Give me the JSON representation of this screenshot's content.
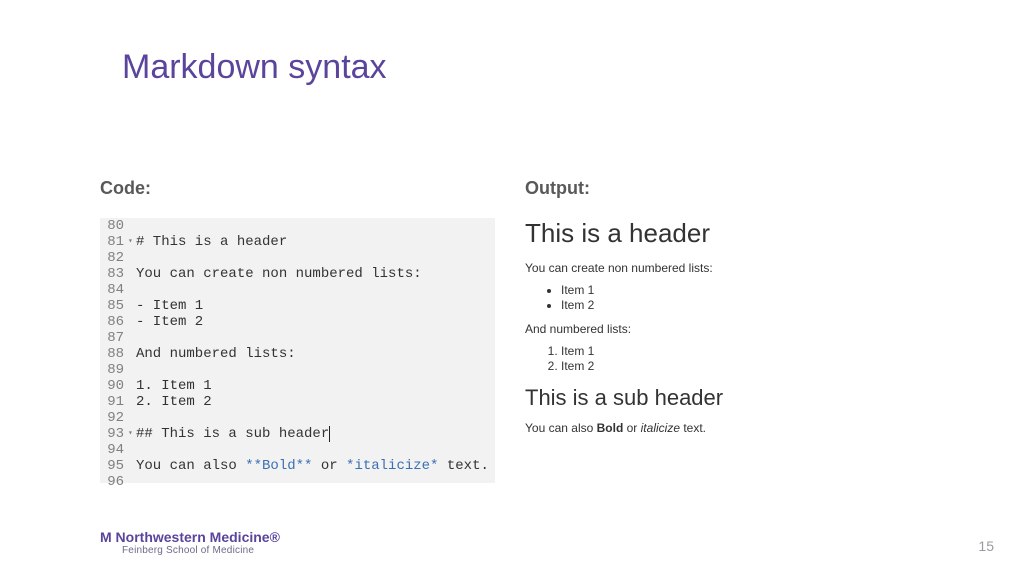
{
  "title": "Markdown syntax",
  "labels": {
    "code": "Code:",
    "output": "Output:"
  },
  "code": {
    "lines": [
      {
        "num": "80",
        "fold": "",
        "text": ""
      },
      {
        "num": "81",
        "fold": "▾",
        "text": "# This is a header"
      },
      {
        "num": "82",
        "fold": "",
        "text": ""
      },
      {
        "num": "83",
        "fold": "",
        "text": "You can create non numbered lists:"
      },
      {
        "num": "84",
        "fold": "",
        "text": ""
      },
      {
        "num": "85",
        "fold": "",
        "text": "- Item 1"
      },
      {
        "num": "86",
        "fold": "",
        "text": "- Item 2"
      },
      {
        "num": "87",
        "fold": "",
        "text": ""
      },
      {
        "num": "88",
        "fold": "",
        "text": "And numbered lists:"
      },
      {
        "num": "89",
        "fold": "",
        "text": ""
      },
      {
        "num": "90",
        "fold": "",
        "text": "1. Item 1"
      },
      {
        "num": "91",
        "fold": "",
        "text": "2. Item 2"
      },
      {
        "num": "92",
        "fold": "",
        "text": ""
      },
      {
        "num": "93",
        "fold": "▾",
        "text": "## This is a sub header",
        "cursor": true
      },
      {
        "num": "94",
        "fold": "",
        "text": ""
      },
      {
        "num": "95",
        "fold": "",
        "segments": [
          {
            "t": "You can also "
          },
          {
            "t": "**Bold**",
            "cls": "blue"
          },
          {
            "t": " or "
          },
          {
            "t": "*italicize*",
            "cls": "blue"
          },
          {
            "t": " text."
          }
        ]
      },
      {
        "num": "96",
        "fold": "",
        "text": ""
      }
    ]
  },
  "output": {
    "h1": "This is a header",
    "p1": "You can create non numbered lists:",
    "ul": [
      "Item 1",
      "Item 2"
    ],
    "p2": "And numbered lists:",
    "ol": [
      "Item 1",
      "Item 2"
    ],
    "h2": "This is a sub header",
    "p3_parts": {
      "a": "You can also ",
      "bold": "Bold",
      "b": " or ",
      "ital": "italicize",
      "c": " text."
    }
  },
  "footer": {
    "logo_main": "M Northwestern Medicine®",
    "logo_sub": "Feinberg School of Medicine",
    "page": "15"
  }
}
